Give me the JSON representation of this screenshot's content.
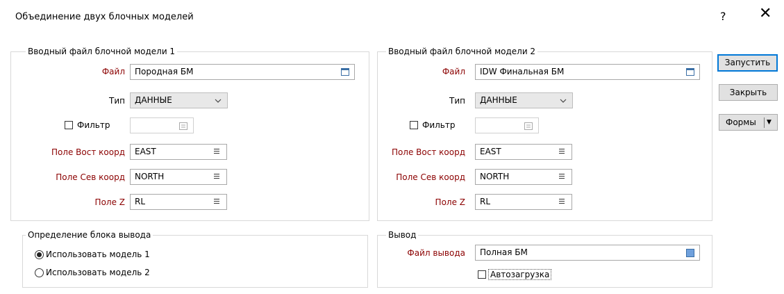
{
  "dialog": {
    "title": "Объединение двух блочных моделей",
    "help": "?",
    "close": "✕"
  },
  "input1": {
    "legend": "Вводный файл блочной модели 1",
    "file_label": "Файл",
    "file_value": "Породная БМ",
    "type_label": "Тип",
    "type_value": "ДАННЫЕ",
    "filter_label": "Фильтр",
    "east_label": "Поле Вост коорд",
    "east_value": "EAST",
    "north_label": "Поле Сев коорд",
    "north_value": "NORTH",
    "z_label": "Поле Z",
    "z_value": "RL"
  },
  "input2": {
    "legend": "Вводный файл блочной модели 2",
    "file_label": "Файл",
    "file_value": "IDW Финальная БМ",
    "type_label": "Тип",
    "type_value": "ДАННЫЕ",
    "filter_label": "Фильтр",
    "east_label": "Поле Вост коорд",
    "east_value": "EAST",
    "north_label": "Поле Сев коорд",
    "north_value": "NORTH",
    "z_label": "Поле Z",
    "z_value": "RL"
  },
  "block_def": {
    "legend": "Определение блока вывода",
    "option1": "Использовать модель 1",
    "option2": "Использовать модель 2",
    "selected": "option1"
  },
  "output": {
    "legend": "Вывод",
    "file_label": "Файл вывода",
    "file_value": "Полная БМ",
    "autoload_label": "Автозагрузка"
  },
  "buttons": {
    "run": "Запустить",
    "close": "Закрыть",
    "forms": "Формы",
    "forms_arrow": "▼"
  },
  "icons": {
    "checkbox": "checkbox-icon",
    "file_browse": "file-browse-icon",
    "field_list": "field-list-icon",
    "dropdown": "chevron-down-icon"
  },
  "colors": {
    "required_label": "#8b0000",
    "default_button_border": "#0078d7",
    "file_icon": "#3a6ea5"
  }
}
